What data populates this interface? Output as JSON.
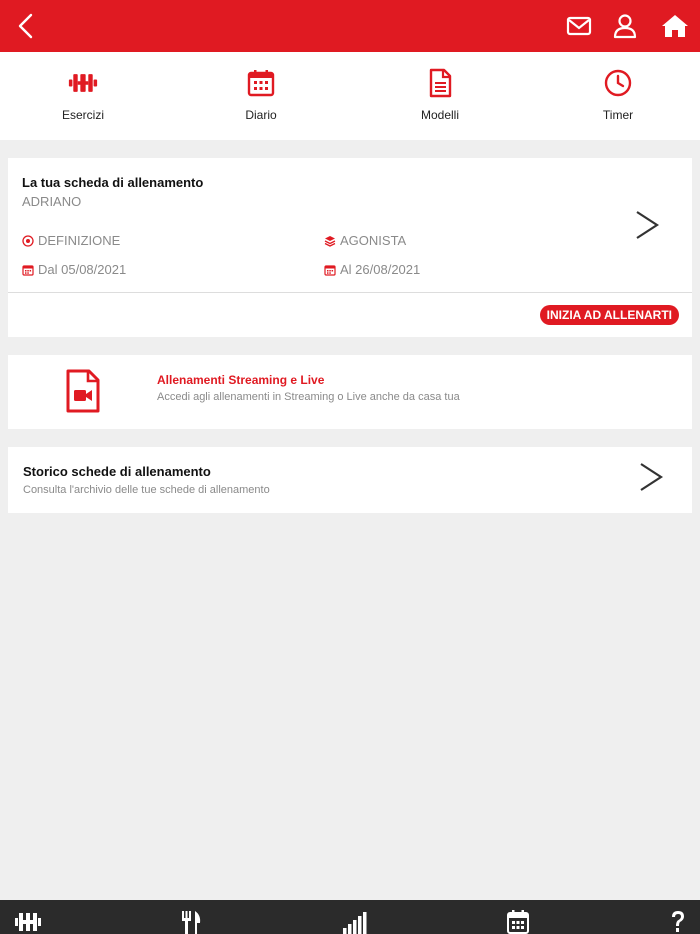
{
  "nav": {
    "items": [
      {
        "label": "Esercizi",
        "icon": "dumbbell-icon"
      },
      {
        "label": "Diario",
        "icon": "calendar-icon"
      },
      {
        "label": "Modelli",
        "icon": "document-icon"
      },
      {
        "label": "Timer",
        "icon": "clock-icon"
      }
    ]
  },
  "current_plan": {
    "title": "La tua scheda di allenamento",
    "owner": "ADRIANO",
    "goal": "DEFINIZIONE",
    "level": "AGONISTA",
    "start": "Dal 05/08/2021",
    "end": "Al 26/08/2021",
    "start_button": "INIZIA AD ALLENARTI"
  },
  "streaming": {
    "title": "Allenamenti Streaming e Live",
    "subtitle": "Accedi agli allenamenti in Streaming o Live anche da casa tua"
  },
  "history": {
    "title": "Storico schede di allenamento",
    "subtitle": "Consulta l'archivio delle tue schede di allenamento"
  },
  "bottom_bar": {
    "icons": [
      "dumbbell-icon",
      "fork-knife-icon",
      "signal-bars-icon",
      "calendar-icon",
      "help-icon"
    ]
  },
  "colors": {
    "accent": "#e01a22",
    "bottom_bar": "#2b2b2b",
    "background": "#efefef"
  }
}
